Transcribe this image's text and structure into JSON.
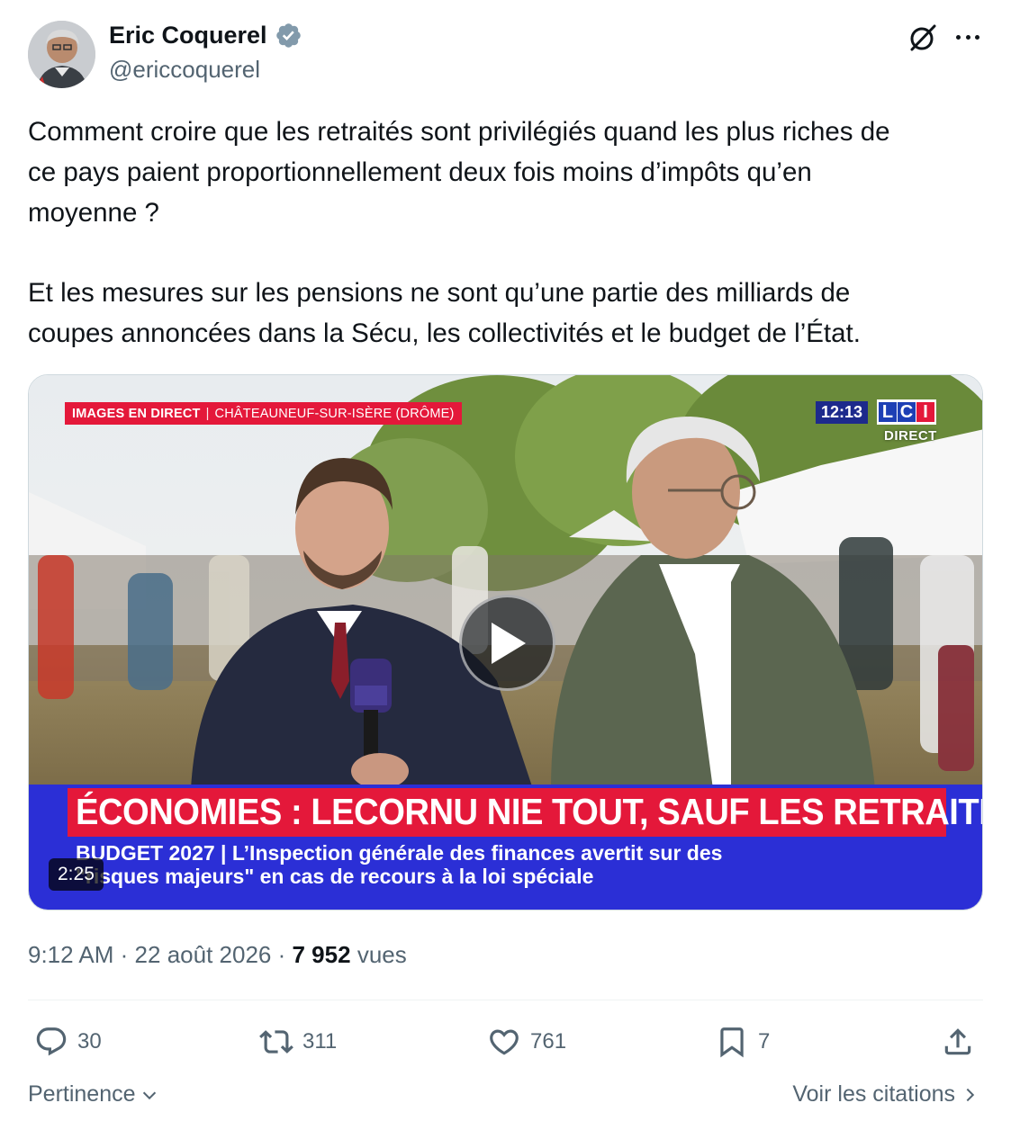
{
  "author": {
    "name": "Eric Coquerel",
    "handle": "@ericcoquerel",
    "verified_icon": "verified-badge-icon"
  },
  "tweet": {
    "paragraphs": [
      "Comment croire que les retraités sont privilégiés quand les plus riches de\nce pays paient proportionnellement deux fois moins d’impôts qu’en\nmoyenne ?",
      "Et les mesures sur les pensions ne sont qu’une partie des milliards de\ncoupes annoncées dans la Sécu, les collectivités et le budget de l’État."
    ]
  },
  "video": {
    "live_tag": "IMAGES EN DIRECT",
    "separator": "|",
    "location": "CHÂTEAUNEUF-SUR-ISÈRE (DRÔME)",
    "clock": "12:13",
    "channel_logo": [
      "L",
      "C",
      "I"
    ],
    "direct_label": "DIRECT",
    "mic_label": "LCI",
    "headline": "ÉCONOMIES : LECORNU NIE TOUT, SAUF LES RETRAITES",
    "subline_1": "BUDGET 2027 | L’Inspection générale des finances avertit sur des",
    "subline_2": "\"risques majeurs\" en cas de recours à la loi spéciale",
    "duration": "2:25"
  },
  "meta": {
    "time": "9:12 AM",
    "dot": "·",
    "date": "22 août 2026",
    "views_count": "7 952",
    "views_label": "vues"
  },
  "actions": {
    "replies": "30",
    "retweets": "311",
    "likes": "761",
    "bookmarks": "7"
  },
  "footer": {
    "sort_label": "Pertinence",
    "quotes_label": "Voir les citations"
  },
  "colors": {
    "text": "#0f1419",
    "secondary": "#536471",
    "verified": "#829aab",
    "lci_red": "#e4183a",
    "lci_blue": "#2b2fd6"
  }
}
